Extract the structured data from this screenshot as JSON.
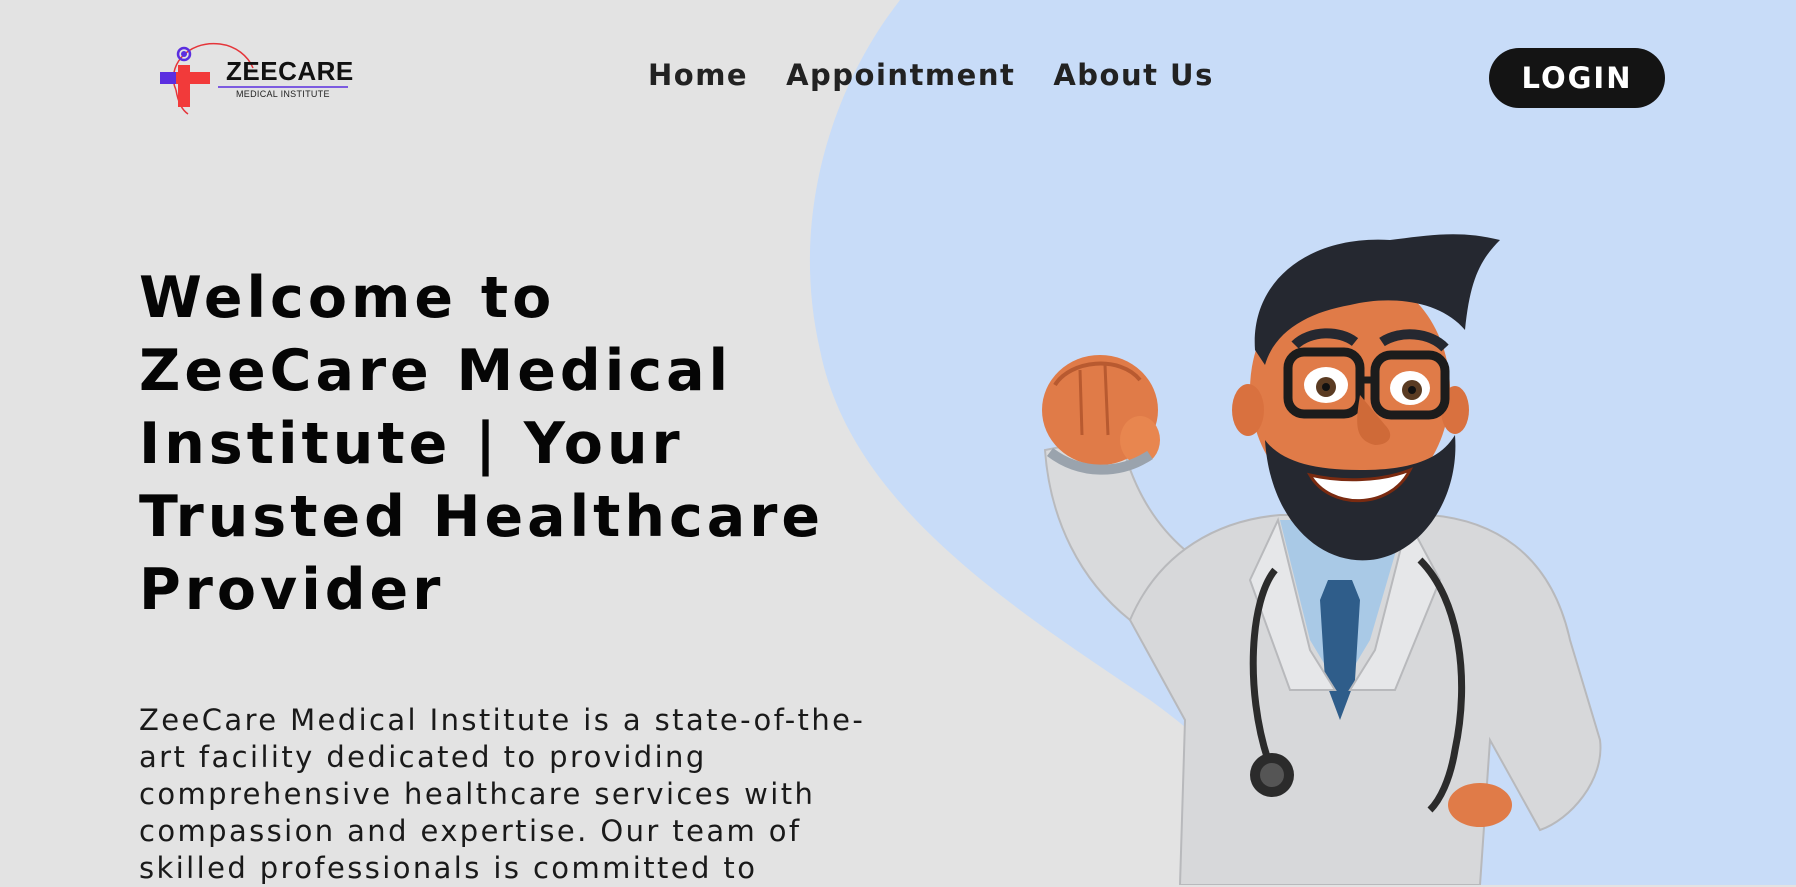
{
  "brand": {
    "name": "ZEECARE",
    "subtitle": "MEDICAL INSTITUTE"
  },
  "nav": {
    "items": [
      {
        "label": "Home"
      },
      {
        "label": "Appointment"
      },
      {
        "label": "About Us"
      }
    ],
    "login_label": "LOGIN"
  },
  "hero": {
    "title": "Welcome to ZeeCare Medical Institute | Your Trusted Healthcare Provider",
    "description": "ZeeCare Medical Institute is a state-of-the-art facility dedicated to providing comprehensive healthcare services with compassion and expertise. Our team of skilled professionals is committed to"
  },
  "colors": {
    "background": "#e3e3e3",
    "accent_shape": "#c8dcf8",
    "login_button": "#141414"
  },
  "icons": [
    "medical-cross-logo-icon",
    "doctor-illustration"
  ]
}
